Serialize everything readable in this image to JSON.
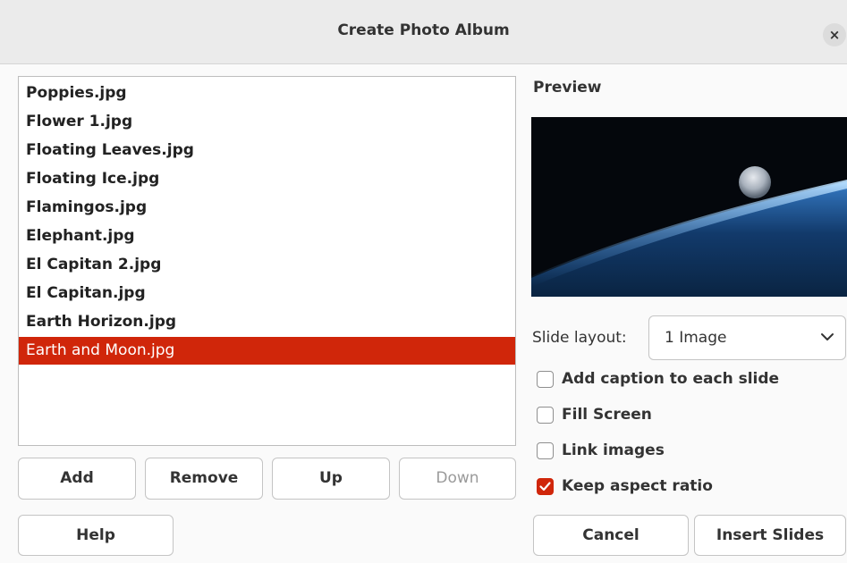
{
  "window": {
    "title": "Create Photo Album",
    "close_icon": "×"
  },
  "file_list": {
    "items": [
      {
        "label": "Poppies.jpg",
        "selected": false
      },
      {
        "label": "Flower 1.jpg",
        "selected": false
      },
      {
        "label": "Floating Leaves.jpg",
        "selected": false
      },
      {
        "label": "Floating Ice.jpg",
        "selected": false
      },
      {
        "label": "Flamingos.jpg",
        "selected": false
      },
      {
        "label": "Elephant.jpg",
        "selected": false
      },
      {
        "label": "El Capitan 2.jpg",
        "selected": false
      },
      {
        "label": "El Capitan.jpg",
        "selected": false
      },
      {
        "label": "Earth Horizon.jpg",
        "selected": false
      },
      {
        "label": "Earth and Moon.jpg",
        "selected": true
      }
    ],
    "selection_color": "#d0260a"
  },
  "list_buttons": {
    "add": "Add",
    "remove": "Remove",
    "up": "Up",
    "down": "Down"
  },
  "preview": {
    "label": "Preview",
    "image": "earth-and-moon-photo"
  },
  "slide_layout": {
    "label": "Slide layout:",
    "value": "1 Image"
  },
  "options": {
    "add_caption": {
      "label": "Add caption to each slide",
      "checked": false
    },
    "fill_screen": {
      "label": "Fill Screen",
      "checked": false
    },
    "link_images": {
      "label": "Link images",
      "checked": false
    },
    "keep_aspect": {
      "label": "Keep aspect ratio",
      "checked": true
    }
  },
  "footer": {
    "help": "Help",
    "cancel": "Cancel",
    "insert": "Insert Slides"
  },
  "colors": {
    "accent": "#d0260a",
    "dialog_bg": "#fafafa"
  }
}
